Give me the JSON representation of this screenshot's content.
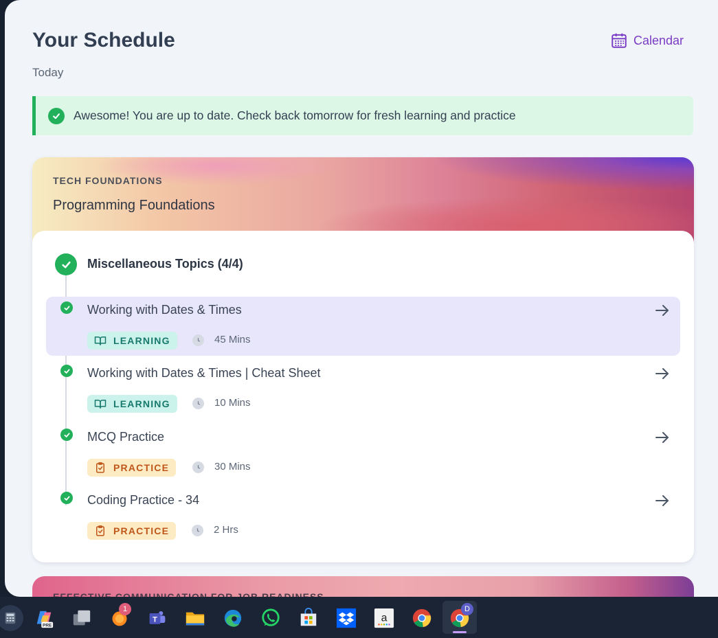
{
  "header": {
    "title": "Your Schedule",
    "subtitle": "Today",
    "calendar_label": "Calendar"
  },
  "banner": {
    "message": "Awesome! You are up to date. Check back tomorrow for fresh learning and practice"
  },
  "course": {
    "category": "TECH FOUNDATIONS",
    "name": "Programming Foundations",
    "module": {
      "title": "Miscellaneous Topics (4/4)",
      "items": [
        {
          "title": "Working with Dates & Times",
          "type": "LEARNING",
          "duration": "45 Mins",
          "active": true
        },
        {
          "title": "Working with Dates & Times | Cheat Sheet",
          "type": "LEARNING",
          "duration": "10 Mins",
          "active": false
        },
        {
          "title": "MCQ Practice",
          "type": "PRACTICE",
          "duration": "30 Mins",
          "active": false
        },
        {
          "title": "Coding Practice - 34",
          "type": "PRACTICE",
          "duration": "2 Hrs",
          "active": false
        }
      ]
    }
  },
  "next_course": {
    "category": "EFFECTIVE COMMUNICATION FOR JOB READINESS"
  },
  "taskbar": {
    "icons": [
      "calculator-icon",
      "copilot-icon",
      "task-view-icon",
      "firefox-icon",
      "teams-icon",
      "file-explorer-icon",
      "edge-icon",
      "whatsapp-icon",
      "microsoft-store-icon",
      "dropbox-icon",
      "amazon-icon",
      "chrome-icon",
      "chrome-profile-icon"
    ],
    "copilot_badge": "PRE",
    "firefox_badge": "1",
    "chrome_profile_badge": "D"
  },
  "colors": {
    "accent_purple": "#7a3cc4",
    "success_green": "#22b15a",
    "learning_bg": "#ccf2ec",
    "practice_bg": "#fdebc4",
    "active_row": "#e8e6fb"
  }
}
